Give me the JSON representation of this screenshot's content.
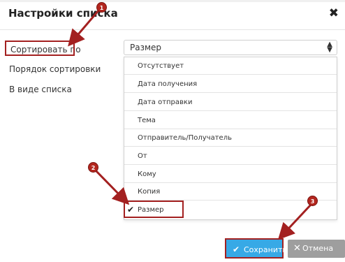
{
  "dialog": {
    "title": "Настройки списка",
    "close_glyph": "✖"
  },
  "form": {
    "sort_label": "Сортировать по",
    "order_label": "Порядок сортировки",
    "list_label": "В виде списка",
    "sort_select_value": "Размер"
  },
  "dropdown": {
    "options": [
      {
        "label": "Отсутствует",
        "selected": false
      },
      {
        "label": "Дата получения",
        "selected": false
      },
      {
        "label": "Дата отправки",
        "selected": false
      },
      {
        "label": "Тема",
        "selected": false
      },
      {
        "label": "Отправитель/Получатель",
        "selected": false
      },
      {
        "label": "От",
        "selected": false
      },
      {
        "label": "Кому",
        "selected": false
      },
      {
        "label": "Копия",
        "selected": false
      },
      {
        "label": "Размер",
        "selected": true
      }
    ]
  },
  "buttons": {
    "save_label": "Сохранить",
    "cancel_label": "Отмена"
  },
  "callouts": [
    "1",
    "2",
    "3"
  ],
  "colors": {
    "accent_blue": "#37a9e6",
    "callout_red": "#a32020",
    "cancel_gray": "#9e9e9e"
  }
}
